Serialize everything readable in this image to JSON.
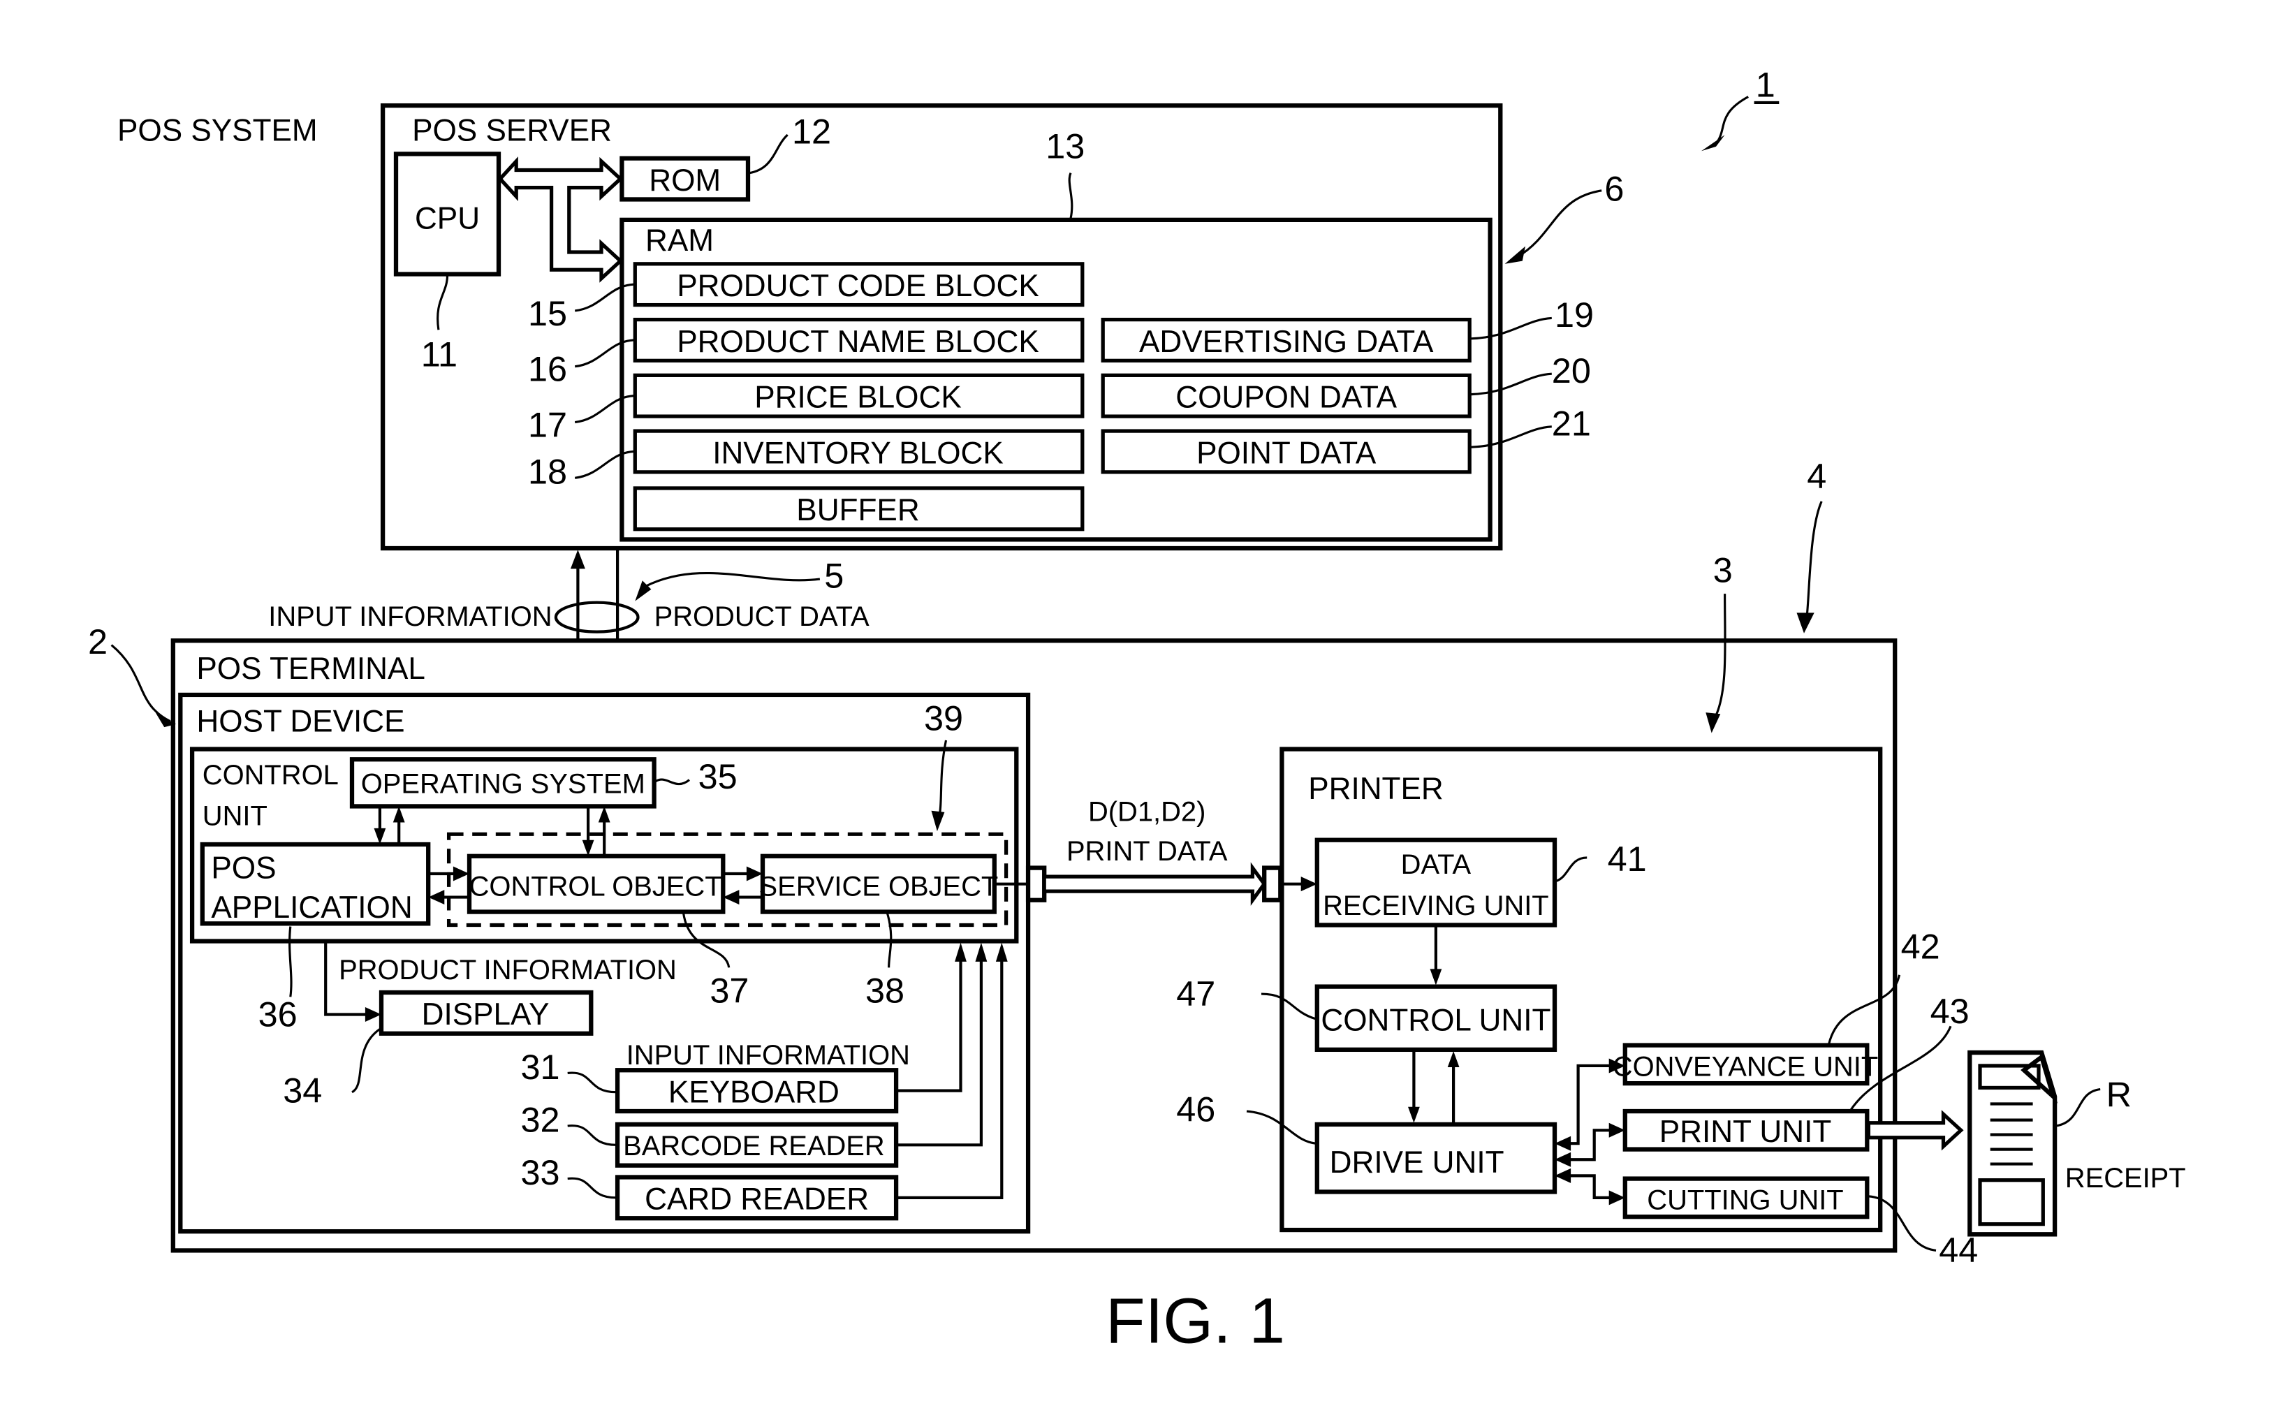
{
  "figure": {
    "caption": "FIG. 1",
    "system_label": "POS SYSTEM",
    "system_ref": "1"
  },
  "server": {
    "title": "POS SERVER",
    "ref": "6",
    "cpu": {
      "label": "CPU",
      "ref": "11"
    },
    "rom": {
      "label": "ROM",
      "ref": "12"
    },
    "ram": {
      "label": "RAM",
      "ref": "13",
      "blocks": [
        {
          "label": "PRODUCT CODE BLOCK",
          "ref": "15"
        },
        {
          "label": "PRODUCT NAME BLOCK",
          "ref": "16"
        },
        {
          "label": "PRICE BLOCK",
          "ref": "17"
        },
        {
          "label": "INVENTORY BLOCK",
          "ref": "18"
        },
        {
          "label": "BUFFER",
          "ref": ""
        }
      ],
      "data": [
        {
          "label": "ADVERTISING DATA",
          "ref": "19"
        },
        {
          "label": "COUPON DATA",
          "ref": "20"
        },
        {
          "label": "POINT DATA",
          "ref": "21"
        }
      ]
    }
  },
  "network": {
    "ref": "5",
    "up_label": "INPUT INFORMATION",
    "down_label": "PRODUCT DATA"
  },
  "terminal": {
    "title": "POS TERMINAL",
    "ref": "2",
    "group_ref": "4",
    "host": {
      "title": "HOST DEVICE",
      "control_unit": {
        "label_line1": "CONTROL",
        "label_line2": "UNIT"
      },
      "os": {
        "label": "OPERATING SYSTEM",
        "ref": "35"
      },
      "pos_app": {
        "label_line1": "POS",
        "label_line2": "APPLICATION",
        "ref": "36"
      },
      "driver_group_ref": "39",
      "control_object": {
        "label": "CONTROL OBJECT",
        "ref": "37"
      },
      "service_object": {
        "label": "SERVICE OBJECT",
        "ref": "38"
      },
      "product_info_label": "PRODUCT INFORMATION",
      "display": {
        "label": "DISPLAY",
        "ref": "34"
      },
      "input_info_label": "INPUT INFORMATION",
      "inputs": [
        {
          "label": "KEYBOARD",
          "ref": "31"
        },
        {
          "label": "BARCODE READER",
          "ref": "32"
        },
        {
          "label": "CARD READER",
          "ref": "33"
        }
      ]
    },
    "print_data": {
      "line1": "D(D1,D2)",
      "line2": "PRINT DATA"
    },
    "printer": {
      "title": "PRINTER",
      "ref": "3",
      "data_receiving": {
        "label_line1": "DATA",
        "label_line2": "RECEIVING UNIT",
        "ref": "41"
      },
      "control_unit": {
        "label": "CONTROL UNIT",
        "ref": "47"
      },
      "drive_unit": {
        "label": "DRIVE UNIT",
        "ref": "46"
      },
      "conveyance_unit": {
        "label": "CONVEYANCE UNIT",
        "ref": "42"
      },
      "print_unit": {
        "label": "PRINT UNIT",
        "ref": "43"
      },
      "cutting_unit": {
        "label": "CUTTING UNIT",
        "ref": "44"
      }
    }
  },
  "receipt": {
    "label": "RECEIPT",
    "ref": "R"
  }
}
